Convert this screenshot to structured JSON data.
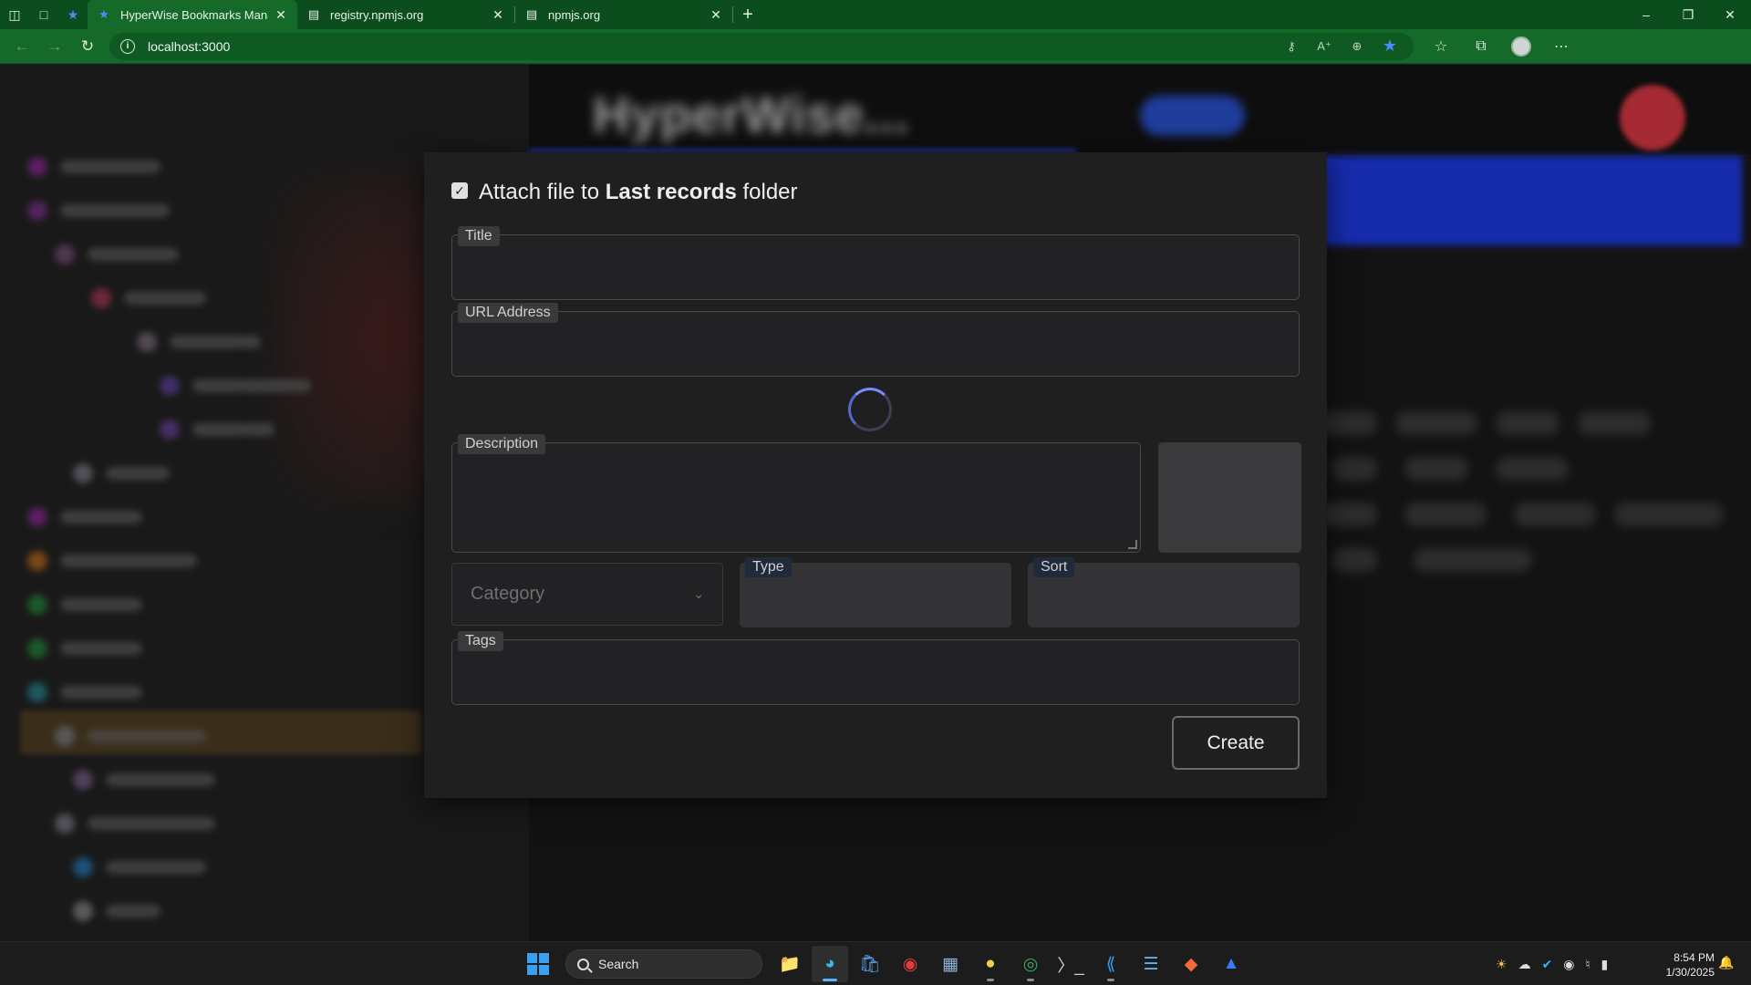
{
  "browser": {
    "tabs": [
      {
        "title": "HyperWise Bookmarks Manager",
        "active": true,
        "favicon": "bookmark-star-icon"
      },
      {
        "title": "registry.npmjs.org",
        "active": false,
        "favicon": "page-icon"
      },
      {
        "title": "npmjs.org",
        "active": false,
        "favicon": "page-icon"
      }
    ],
    "url": "localhost:3000",
    "accent_color": "#156a2a"
  },
  "modal": {
    "attach_prefix": "Attach file to",
    "attach_folder": "Last records",
    "attach_suffix": "folder",
    "attach_checked": true,
    "fields": {
      "title_label": "Title",
      "title_value": "",
      "url_label": "URL Address",
      "url_value": "",
      "description_label": "Description",
      "description_value": "",
      "category_placeholder": "Category",
      "type_label": "Type",
      "sort_label": "Sort",
      "tags_label": "Tags"
    },
    "create_label": "Create"
  },
  "taskbar": {
    "search_label": "Search",
    "time": "8:54 PM",
    "date": "1/30/2025"
  }
}
